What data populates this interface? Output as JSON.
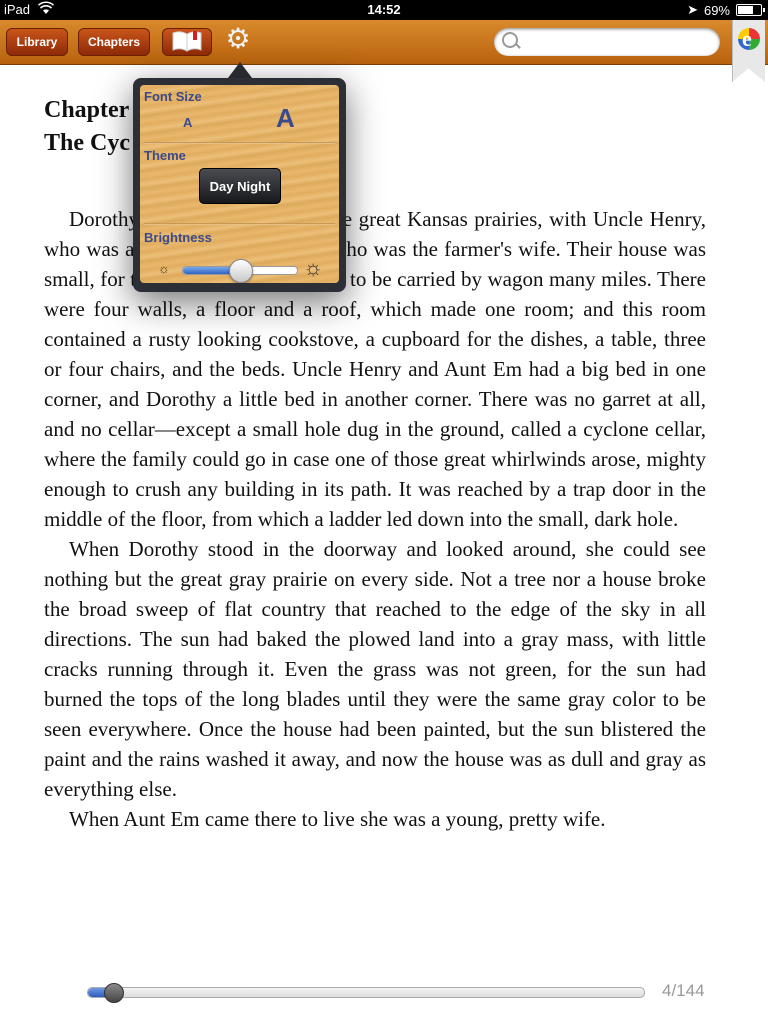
{
  "status_bar": {
    "carrier": "iPad",
    "time": "14:52",
    "battery": "69%",
    "battery_level": 0.69
  },
  "toolbar": {
    "library_label": "Library",
    "chapters_label": "Chapters",
    "book_icon": "open-book-icon",
    "settings_icon": "gear-icon",
    "search_placeholder": "",
    "search_value": ""
  },
  "book": {
    "chapter_title_line1": "Chapter",
    "chapter_title_line2": "The Cyc",
    "paragraphs": [
      "Dorothy lived in the midst of the great Kansas prairies, with Uncle Henry, who was a farmer, and Aunt Em, who was the farmer's wife. Their house was small, for the lumber to build it had to be carried by wagon many miles. There were four walls, a floor and a roof, which made one room; and this room contained a rusty looking cookstove, a cupboard for the dishes, a table, three or four chairs, and the beds. Uncle Henry and Aunt Em had a big bed in one corner, and Dorothy a little bed in another corner. There was no garret at all, and no cellar—except a small hole dug in the ground, called a cyclone cellar, where the family could go in case one of those great whirlwinds arose, mighty enough to crush any building in its path. It was reached by a trap door in the middle of the floor, from which a ladder led down into the small, dark hole.",
      "When Dorothy stood in the doorway and looked around, she could see nothing but the great gray prairie on every side. Not a tree nor a house broke the broad sweep of flat country that reached to the edge of the sky in all directions. The sun had baked the plowed land into a gray mass, with little cracks running through it. Even the grass was not green, for the sun had burned the tops of the long blades until they were the same gray color to be seen everywhere. Once the house had been painted, but the sun blistered the paint and the rains washed it away, and now the house was as dull and gray as everything else.",
      "When Aunt Em came there to live she was a young, pretty wife."
    ]
  },
  "settings_popover": {
    "font_size_label": "Font Size",
    "font_small": "A",
    "font_large": "A",
    "theme_label": "Theme",
    "theme_button": "Day Night",
    "brightness_label": "Brightness",
    "brightness_level": 0.5
  },
  "progress": {
    "page_count": "4/144",
    "fraction": 0.045
  },
  "colors": {
    "toolbar": "#c8731b",
    "button": "#a83a10",
    "popover_text": "#3a4a8a",
    "progress_fill": "#2a5cbf"
  }
}
